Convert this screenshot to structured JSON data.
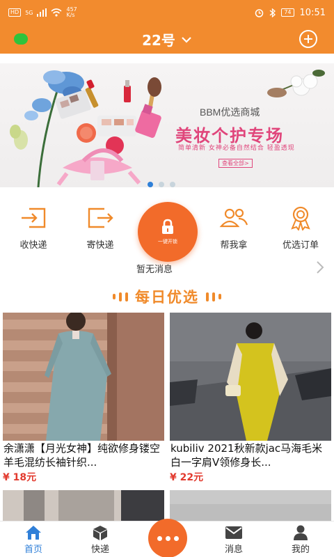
{
  "status_bar": {
    "hd": "HD",
    "signal": "5G",
    "speed_value": "457",
    "speed_unit": "K/s",
    "battery": "74",
    "time": "10:51"
  },
  "header": {
    "title": "22号",
    "online": true,
    "color": "#f28b2e"
  },
  "banner": {
    "brand": "BBM优选商城",
    "headline": "美妆个护专场",
    "subline": "简单清新 女神必备自然结合 轻盈透现",
    "view_all": "查看全部>",
    "slide_count": 3,
    "active_slide": 1
  },
  "actions": [
    {
      "label": "收快递",
      "icon": "receive-package-icon"
    },
    {
      "label": "寄快递",
      "icon": "send-package-icon"
    },
    {
      "label": "帮我拿",
      "icon": "users-icon"
    },
    {
      "label": "优选订单",
      "icon": "award-icon"
    }
  ],
  "unlock": {
    "label": "一键开锁",
    "icon": "lock-icon"
  },
  "notice": {
    "text": "暂无消息"
  },
  "section": {
    "title": "每日优选"
  },
  "products": [
    {
      "name": "余潇潇【月光女神】纯欲修身镂空羊毛混纺长袖针织...",
      "price": "¥ 18元"
    },
    {
      "name": "kubiliv 2021秋新款jac马海毛米白一字肩V领修身长...",
      "price": "¥ 22元"
    }
  ],
  "nav": [
    {
      "label": "首页",
      "icon": "home-icon",
      "active": true
    },
    {
      "label": "快递",
      "icon": "box-icon",
      "active": false
    },
    {
      "label": "消息",
      "icon": "mail-icon",
      "active": false
    },
    {
      "label": "我的",
      "icon": "user-icon",
      "active": false
    }
  ],
  "colors": {
    "accent": "#f28b2e",
    "unlock": "#f26b2a",
    "price": "#e23a2e",
    "nav_active": "#2f7fd8",
    "banner_text": "#e0457b"
  }
}
